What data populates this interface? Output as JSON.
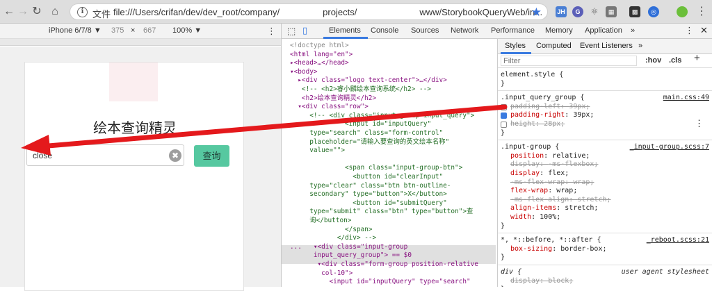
{
  "browser": {
    "scheme": "文件",
    "url_left": "file:///Users/crifan/dev/dev_root/company/",
    "url_mid": "projects/",
    "url_right": "www/StorybookQueryWeb/in...",
    "extensions": [
      "JH",
      "G",
      "⚛",
      "▦",
      "▩",
      "◎"
    ]
  },
  "device_toolbar": {
    "device": "iPhone 6/7/8 ▼",
    "width": "375",
    "times": "×",
    "height": "667",
    "zoom": "100% ▼",
    "more": "⋮"
  },
  "page": {
    "title": "绘本查询精灵",
    "input_value": "close",
    "clear_label": "✖",
    "submit_label": "查询"
  },
  "devtools": {
    "tabs": [
      "Elements",
      "Console",
      "Sources",
      "Network",
      "Performance",
      "Memory",
      "Application",
      "»"
    ],
    "active_tab": "Elements",
    "style_tabs": [
      "Styles",
      "Computed",
      "Event Listeners",
      "»"
    ],
    "filter_placeholder": "Filter",
    "hov": ":hov",
    "cls": ".cls",
    "plus": "+",
    "elements_lines": [
      {
        "t": "<!doctype html>",
        "c": "gr"
      },
      {
        "t": "<html lang=\"en\">",
        "c": "tag"
      },
      {
        "t": "▸<head>…</head>",
        "c": "tag"
      },
      {
        "t": "▾<body>",
        "c": "tag"
      },
      {
        "t": "  ▸<div class=\"logo text-center\">…</div>",
        "c": "tag"
      },
      {
        "t": "   <!-- <h2>睿小麟绘本查询系统</h2> -->",
        "c": "cm"
      },
      {
        "t": "   <h2>绘本查询精灵</h2>",
        "c": "tag"
      },
      {
        "t": "  ▾<div class=\"row\">",
        "c": "tag"
      },
      {
        "t": "     <!-- <div class=\"input-group input_query\">",
        "c": "cm"
      },
      {
        "t": "              <input id=\"inputQuery\"",
        "c": "cm"
      },
      {
        "t": "     type=\"search\" class=\"form-control\"",
        "c": "cm"
      },
      {
        "t": "     placeholder=\"请输入要查询的英文绘本名称\"",
        "c": "cm"
      },
      {
        "t": "     value=\"\">",
        "c": "cm"
      },
      {
        "t": "",
        "c": "cm"
      },
      {
        "t": "              <span class=\"input-group-btn\">",
        "c": "cm"
      },
      {
        "t": "                <button id=\"clearInput\"",
        "c": "cm"
      },
      {
        "t": "     type=\"clear\" class=\"btn btn-outline-",
        "c": "cm"
      },
      {
        "t": "     secondary\" type=\"button\">X</button>",
        "c": "cm"
      },
      {
        "t": "                <button id=\"submitQuery\"",
        "c": "cm"
      },
      {
        "t": "     type=\"submit\" class=\"btn\" type=\"button\">查",
        "c": "cm"
      },
      {
        "t": "     询</button>",
        "c": "cm"
      },
      {
        "t": "              </span>",
        "c": "cm"
      },
      {
        "t": "            </div> -->",
        "c": "cm"
      },
      {
        "t": "...   ▾<div class=\"input-group",
        "c": "tag"
      },
      {
        "t": "      input_query_group\"> == $0",
        "c": "tag"
      },
      {
        "t": "       ▾<div class=\"form-group position-relative",
        "c": "tag"
      },
      {
        "t": "        col-10\">",
        "c": "tag"
      },
      {
        "t": "          <input id=\"inputQuery\" type=\"search\"",
        "c": "tag"
      }
    ],
    "rules": [
      {
        "selector": "element.style {",
        "source": "",
        "decls": [],
        "close": "}"
      },
      {
        "selector": ".input_query_group {",
        "source": "main.css:49",
        "decls": [
          {
            "p": "padding-left",
            "v": "39px;",
            "off": true,
            "cb": "off"
          },
          {
            "p": "padding-right",
            "v": "39px;",
            "off": false,
            "cb": "on"
          },
          {
            "p": "height",
            "v": "28px;",
            "off": true,
            "cb": "off"
          }
        ],
        "close": "}"
      },
      {
        "selector": ".input-group {",
        "source": "_input-group.scss:7",
        "decls": [
          {
            "p": "position",
            "v": "relative;",
            "off": false
          },
          {
            "p": "display",
            "v": "-ms-flexbox;",
            "off": true
          },
          {
            "p": "display",
            "v": "flex;",
            "off": false
          },
          {
            "p": "-ms-flex-wrap",
            "v": "wrap;",
            "off": true
          },
          {
            "p": "flex-wrap",
            "v": "wrap;",
            "off": false
          },
          {
            "p": "-ms-flex-align",
            "v": "stretch;",
            "off": true
          },
          {
            "p": "align-items",
            "v": "stretch;",
            "off": false
          },
          {
            "p": "width",
            "v": "100%;",
            "off": false
          }
        ],
        "close": "}"
      },
      {
        "selector": "*, *::before, *::after {",
        "source": "_reboot.scss:21",
        "decls": [
          {
            "p": "box-sizing",
            "v": "border-box;",
            "off": false
          }
        ],
        "close": "}"
      },
      {
        "selector": "div {",
        "source": "user agent stylesheet",
        "decls": [
          {
            "p": "display",
            "v": "block;",
            "off": true
          }
        ],
        "close": "}"
      }
    ]
  }
}
